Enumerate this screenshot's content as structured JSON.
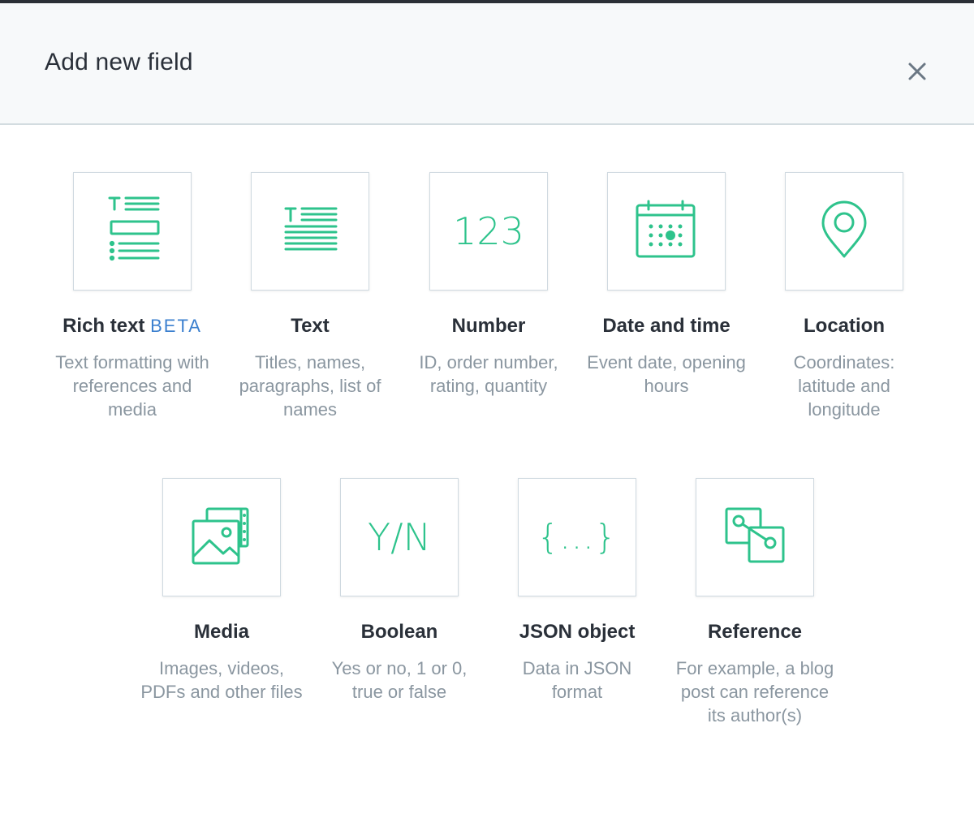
{
  "dialog": {
    "title": "Add new field",
    "close_icon": "close-icon"
  },
  "colors": {
    "accent": "#2ec38c",
    "beta": "#3c80cf",
    "text": "#2a3039",
    "muted": "#8a96a0"
  },
  "fields": [
    {
      "label": "Rich text",
      "badge": "BETA",
      "description": "Text formatting with references and media",
      "icon": "rich-text-icon"
    },
    {
      "label": "Text",
      "description": "Titles, names, paragraphs, list of names",
      "icon": "text-icon"
    },
    {
      "label": "Number",
      "description": "ID, order number, rating, quantity",
      "icon": "number-icon",
      "glyph": "123"
    },
    {
      "label": "Date and time",
      "description": "Event date, opening hours",
      "icon": "calendar-icon"
    },
    {
      "label": "Location",
      "description": "Coordinates: latitude and longitude",
      "icon": "location-pin-icon"
    },
    {
      "label": "Media",
      "description": "Images, videos, PDFs and other files",
      "icon": "media-icon"
    },
    {
      "label": "Boolean",
      "description": "Yes or no, 1 or 0, true or false",
      "icon": "boolean-icon",
      "glyph": "Y/N"
    },
    {
      "label": "JSON object",
      "description": "Data in JSON format",
      "icon": "json-icon",
      "glyph": "{...}"
    },
    {
      "label": "Reference",
      "description": "For example, a blog post can reference its author(s)",
      "icon": "reference-icon"
    }
  ]
}
